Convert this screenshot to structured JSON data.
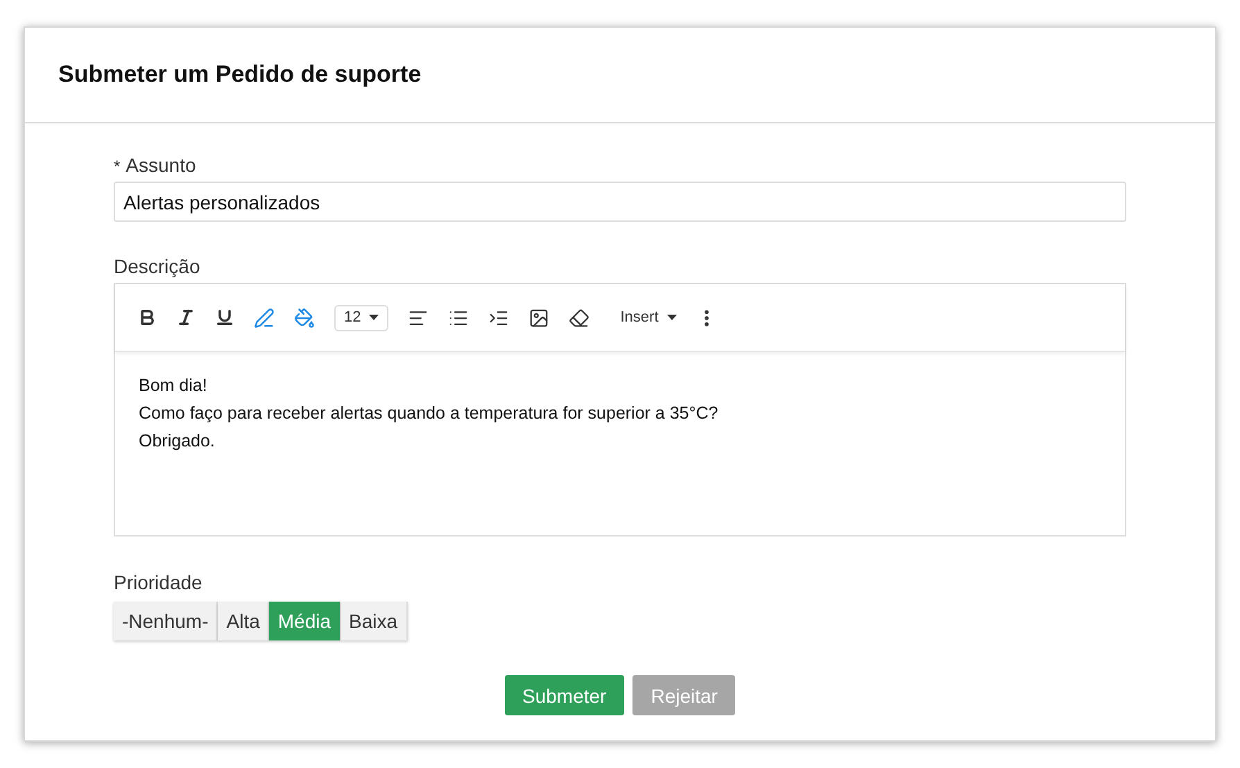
{
  "dialog": {
    "title": "Submeter um Pedido de suporte"
  },
  "subject": {
    "required_mark": "*",
    "label": "Assunto",
    "value": "Alertas personalizados"
  },
  "description": {
    "label": "Descrição",
    "toolbar": {
      "font_size": "12",
      "insert": "Insert"
    },
    "paragraphs": [
      "Bom dia!",
      "Como faço para receber alertas quando a temperatura for superior a 35°C?",
      "Obrigado."
    ]
  },
  "priority": {
    "label": "Prioridade",
    "options": [
      {
        "label": "-Nenhum-",
        "selected": false
      },
      {
        "label": "Alta",
        "selected": false
      },
      {
        "label": "Média",
        "selected": true
      },
      {
        "label": "Baixa",
        "selected": false
      }
    ]
  },
  "buttons": [
    {
      "label": "Submeter",
      "kind": "primary"
    },
    {
      "label": "Rejeitar",
      "kind": "secondary"
    }
  ]
}
